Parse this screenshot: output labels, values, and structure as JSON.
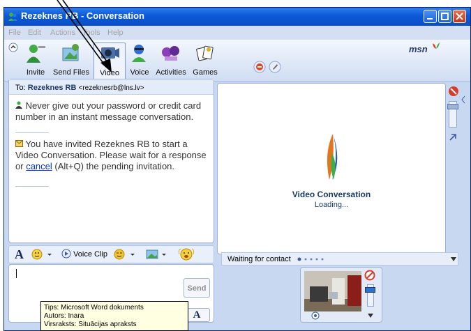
{
  "window": {
    "title": "Rezeknes RB - Conversation"
  },
  "menu": [
    "File",
    "Edit",
    "Actions",
    "Tools",
    "Help"
  ],
  "toolbar": {
    "items": [
      {
        "label": "Invite",
        "icon": "invite-icon"
      },
      {
        "label": "Send Files",
        "icon": "send-files-icon"
      },
      {
        "label": "Video",
        "icon": "video-icon"
      },
      {
        "label": "Voice",
        "icon": "voice-icon"
      },
      {
        "label": "Activities",
        "icon": "activities-icon"
      },
      {
        "label": "Games",
        "icon": "games-icon"
      }
    ],
    "brand": "msn"
  },
  "conversation": {
    "to_prefix": "To:",
    "to_name": "Rezeknes RB",
    "to_email": "<rezeknesrb@lns.lv>",
    "warning": "Never give out your password or credit card number in an instant message conversation.",
    "invite_text_1": "You have invited Rezeknes RB to start a Video Conversation. Please wait for a response or",
    "cancel_link": "cancel",
    "invite_text_2": "(Alt+Q) the pending invitation."
  },
  "format_bar": {
    "font_label": "A",
    "voice_clip": "Voice Clip"
  },
  "input": {
    "value": "",
    "send_label": "Send"
  },
  "tooltip": {
    "line1": "Tips: Microsoft Word dokuments",
    "line2": "Autors: Inara",
    "line3": "Virsraksts: Situācijas apraksts"
  },
  "video": {
    "title": "Video Conversation",
    "status": "Loading..."
  },
  "status_bar": {
    "text": "Waiting for contact"
  },
  "colors": {
    "titlebar": "#0b58d6",
    "pane_border": "#9db1d9",
    "link": "#0033cc",
    "video_title": "#1b3a6b"
  }
}
